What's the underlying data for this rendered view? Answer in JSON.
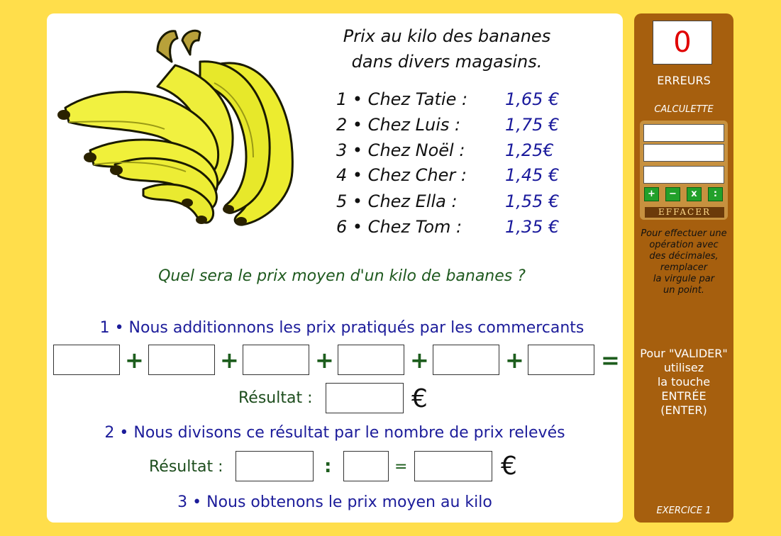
{
  "title": {
    "line1": "Prix au kilo des bananes",
    "line2": "dans divers magasins."
  },
  "shops": [
    {
      "name": "1 • Chez Tatie :",
      "price": "1,65 €"
    },
    {
      "name": "2 • Chez Luis :",
      "price": "1,75 €"
    },
    {
      "name": "3 • Chez Noël :",
      "price": "1,25€"
    },
    {
      "name": "4 • Chez Cher :",
      "price": "1,45 €"
    },
    {
      "name": "5 • Chez Ella :",
      "price": "1,55 €"
    },
    {
      "name": "6 • Chez Tom :",
      "price": "1,35 €"
    }
  ],
  "question": "Quel sera le prix moyen d'un kilo de bananes ?",
  "step1": {
    "label": "1 • Nous additionnons les prix pratiqués par les commercants",
    "operator": "+",
    "equals": "=",
    "result_label": "Résultat :",
    "currency": "€"
  },
  "step2": {
    "label": "2 • Nous divisons ce résultat par le nombre de prix relevés",
    "result_label": "Résultat :",
    "divide": ":",
    "equals": "=",
    "currency": "€"
  },
  "step3": {
    "label": "3 • Nous obtenons le prix moyen au kilo"
  },
  "sidebar": {
    "error_count": "0",
    "errors_label": "ERREURS",
    "calc_label": "CALCULETTE",
    "calc_buttons": [
      "+",
      "−",
      "x",
      ":"
    ],
    "clear_label": "EFFACER",
    "hint_lines": [
      "Pour effectuer une",
      "opération avec",
      "des décimales,",
      "remplacer",
      "la virgule par",
      "un point."
    ],
    "validate_lines": [
      "Pour \"VALIDER\"",
      "utilisez",
      "la touche",
      "ENTRÉE",
      "(ENTER)"
    ],
    "exercise_label": "EXERCICE 1"
  },
  "colors": {
    "background": "#FFDE4B",
    "sidebar": "#A65F0E",
    "price_blue": "#1a1a9c",
    "green_text": "#1d5d1d",
    "error_red": "#E00000"
  }
}
